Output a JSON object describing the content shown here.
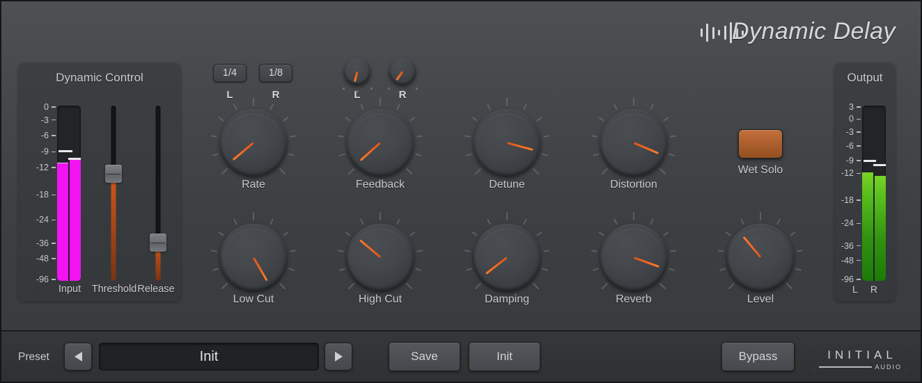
{
  "header": {
    "title": "Dynamic Delay",
    "logo_icon": "waveform-bars-icon"
  },
  "dynamic_control": {
    "title": "Dynamic Control",
    "scale": [
      "0",
      "-3",
      "-6",
      "-9",
      "-12",
      "-18",
      "-24",
      "-36",
      "-48",
      "-96"
    ],
    "scale_pos": [
      0,
      7.5,
      16.5,
      26,
      35,
      51,
      65.5,
      79,
      88,
      100
    ],
    "input_label": "Input",
    "threshold_label": "Threshold",
    "release_label": "Release",
    "input_meter": {
      "left_level_pct": 67,
      "right_level_pct": 70,
      "peak_left_pct": 26.5,
      "peak_right_pct": 31
    },
    "threshold_value_pct": 61,
    "release_value_pct": 22,
    "meter_color": "#f114f1"
  },
  "output": {
    "title": "Output",
    "scale": [
      "3",
      "0",
      "-3",
      "-6",
      "-9",
      "-12",
      "-18",
      "-24",
      "-36",
      "-48",
      "-96"
    ],
    "scale_pos": [
      0,
      7,
      14.5,
      22.5,
      31,
      38.5,
      54,
      67.5,
      80.5,
      89,
      100
    ],
    "left_label": "L",
    "right_label": "R",
    "left_level_pct": 62,
    "right_level_pct": 60,
    "peak_left_pct": 32,
    "peak_right_pct": 34.5,
    "meter_color": "#5cc11d"
  },
  "note_buttons": [
    {
      "label": "1/4",
      "channel": "L"
    },
    {
      "label": "1/8",
      "channel": "R"
    }
  ],
  "small_knobs": [
    {
      "label": "L",
      "angle": 194
    },
    {
      "label": "R",
      "angle": 215
    }
  ],
  "knobs_row1": [
    {
      "label": "Rate",
      "angle": 230
    },
    {
      "label": "Feedback",
      "angle": 228
    },
    {
      "label": "Detune",
      "angle": 105
    },
    {
      "label": "Distortion",
      "angle": 113
    }
  ],
  "knobs_row2": [
    {
      "label": "Low Cut",
      "angle": 150
    },
    {
      "label": "High Cut",
      "angle": 310
    },
    {
      "label": "Damping",
      "angle": 232
    },
    {
      "label": "Reverb",
      "angle": 110
    },
    {
      "label": "Level",
      "angle": 320
    }
  ],
  "wet_solo": {
    "label": "Wet Solo",
    "active": true,
    "color": "#b4652f"
  },
  "bottom": {
    "preset_label": "Preset",
    "prev_icon": "triangle-left-icon",
    "next_icon": "triangle-right-icon",
    "preset_name": "Init",
    "save_label": "Save",
    "init_label": "Init",
    "bypass_label": "Bypass",
    "brand_name": "INITIAL",
    "brand_sub": "AUDIO"
  }
}
